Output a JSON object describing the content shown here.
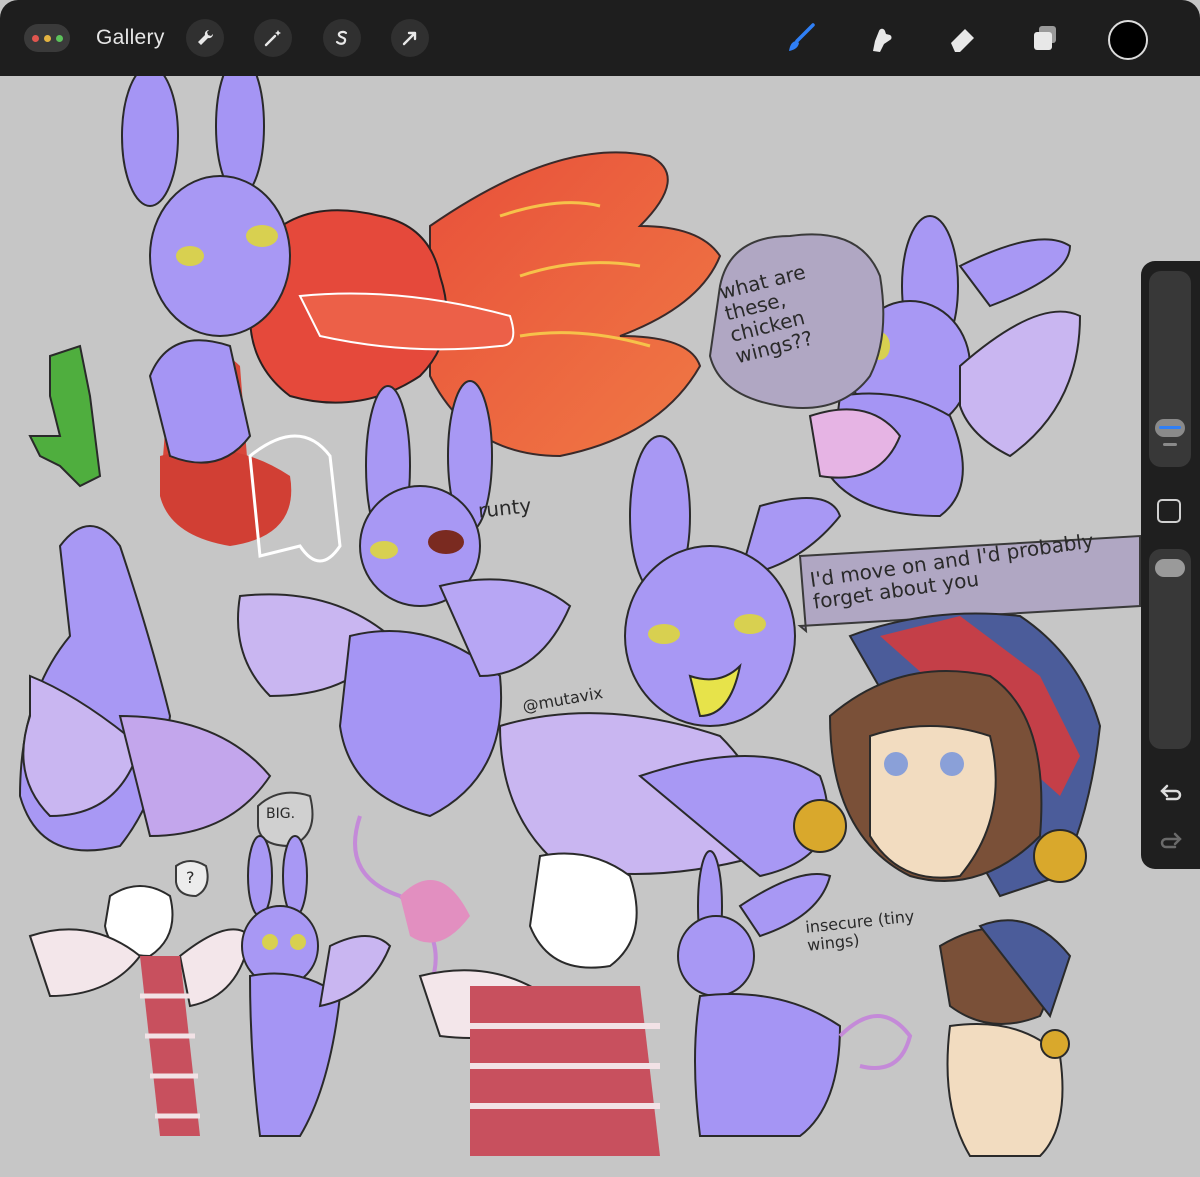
{
  "toolbar": {
    "gallery_label": "Gallery",
    "actions_icon": "wrench-icon",
    "adjustments_icon": "magic-wand-icon",
    "selection_icon": "selection-s-icon",
    "transform_icon": "arrow-icon",
    "brush_icon": "brush-icon",
    "smudge_icon": "smudge-icon",
    "eraser_icon": "eraser-icon",
    "layers_icon": "layers-icon",
    "active_color": "#000000",
    "accent_color": "#2f7ff5"
  },
  "sidebar": {
    "undo_icon": "undo-icon",
    "redo_icon": "redo-icon",
    "modify_icon": "square-icon"
  },
  "canvas": {
    "text_chicken_wings": "what are these, chicken wings??",
    "text_runty": "runty",
    "text_move_on": "I'd move on and I'd probably forget about you",
    "text_watermark": "@mutavix",
    "text_big": "BIG.",
    "text_question": "?",
    "text_insecure": "insecure (tiny wings)"
  }
}
